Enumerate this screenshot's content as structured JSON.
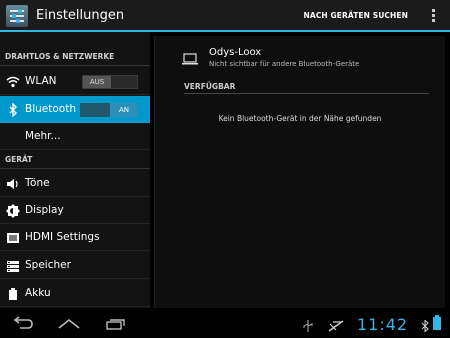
{
  "actionbar": {
    "title": "Einstellungen",
    "scan_label": "NACH GERÄTEN SUCHEN"
  },
  "sidebar": {
    "section_wireless": "DRAHTLOS & NETZWERKE",
    "section_device": "GERÄT",
    "items": [
      {
        "label": "WLAN",
        "icon": "wifi-icon",
        "toggle": "AUS"
      },
      {
        "label": "Bluetooth",
        "icon": "bluetooth-icon",
        "toggle": "AN",
        "selected": true
      },
      {
        "label": "Mehr...",
        "icon": ""
      },
      {
        "label": "Töne",
        "icon": "speaker-icon"
      },
      {
        "label": "Display",
        "icon": "brightness-icon"
      },
      {
        "label": "HDMI Settings",
        "icon": "hdmi-icon"
      },
      {
        "label": "Speicher",
        "icon": "storage-icon"
      },
      {
        "label": "Akku",
        "icon": "battery-icon"
      }
    ]
  },
  "bluetooth": {
    "device_name": "Odys-Loox",
    "device_status": "Nicht sichtbar für andere Bluetooth-Geräte",
    "available_header": "VERFÜGBAR",
    "empty_message": "Kein Bluetooth-Gerät in der Nähe gefunden"
  },
  "statusbar": {
    "time": "11:42"
  },
  "colors": {
    "accent": "#33b5e5",
    "selected": "#0099cc"
  }
}
